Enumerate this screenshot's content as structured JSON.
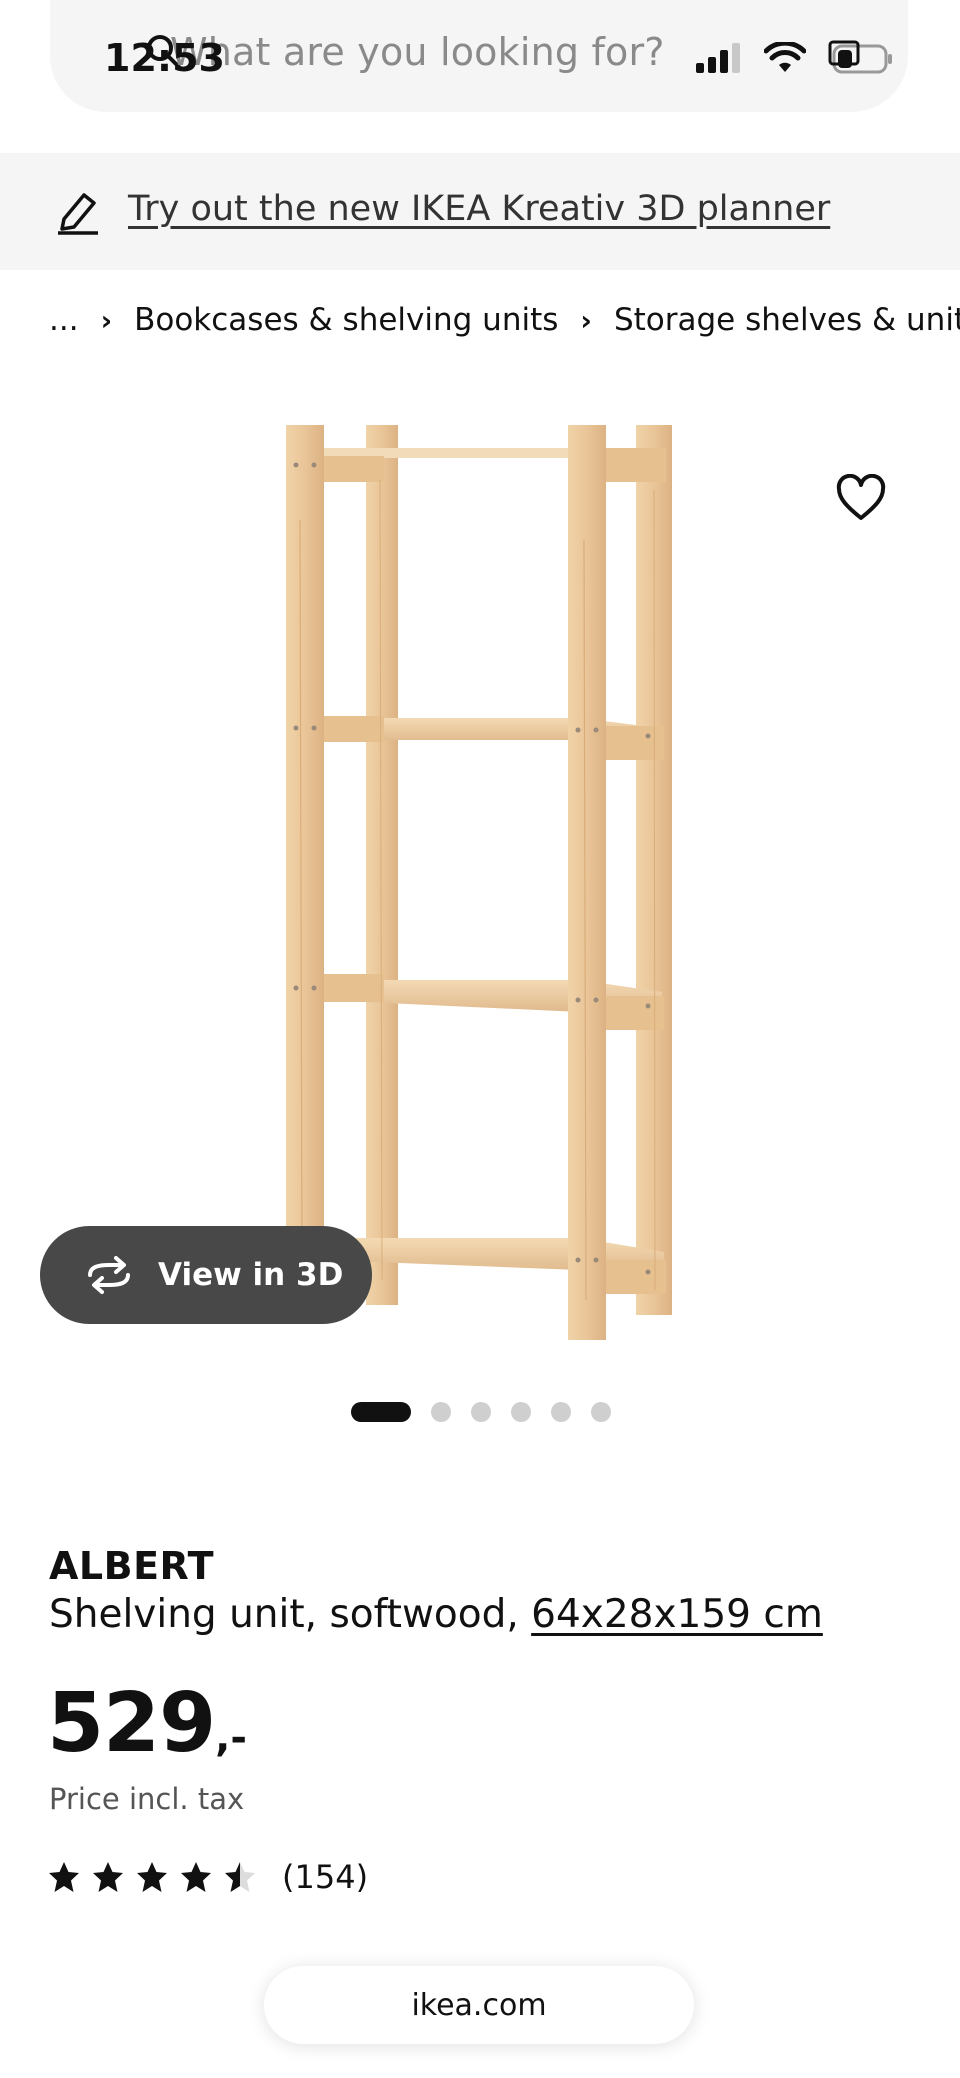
{
  "status_bar": {
    "time": "12:53",
    "icons": [
      "signal-icon",
      "wifi-icon",
      "battery-icon"
    ]
  },
  "search": {
    "placeholder": "What are you looking for?"
  },
  "planner_banner": {
    "link_text": "Try out the new IKEA Kreativ 3D planner"
  },
  "breadcrumb": {
    "items": [
      "...",
      "Bookcases & shelving units",
      "Storage shelves & units"
    ]
  },
  "product_image": {
    "view_3d_label": "View in 3D",
    "carousel": {
      "total": 6,
      "active": 1
    }
  },
  "product": {
    "name": "ALBERT",
    "description_prefix": "Shelving unit, softwood, ",
    "measurements": "64x28x159 cm",
    "price": "529",
    "price_suffix": ",-",
    "price_note": "Price incl. tax",
    "rating": {
      "stars": 4.5,
      "max": 5,
      "count": "(154)"
    }
  },
  "browser": {
    "url": "ikea.com"
  },
  "colors": {
    "wood": "#eac99d",
    "button_dark": "#484848",
    "banner_bg": "#f5f5f5"
  }
}
